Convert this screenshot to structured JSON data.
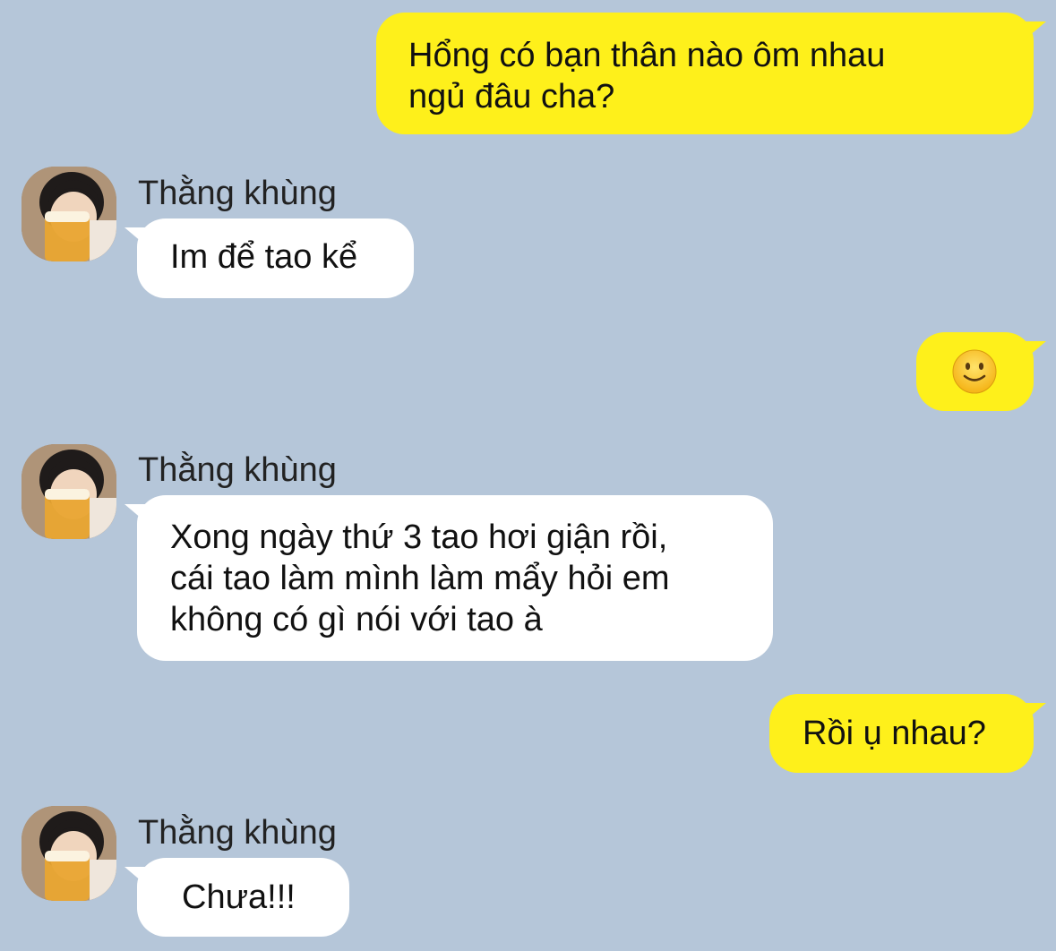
{
  "conversation": {
    "messages": [
      {
        "direction": "outgoing",
        "lines": [
          "Hổng có bạn thân nào ôm nhau",
          "ngủ đâu cha?"
        ]
      },
      {
        "direction": "incoming",
        "sender": "Thằng khùng",
        "text": "Im để tao kể"
      },
      {
        "direction": "outgoing",
        "emoji": "slightly-smiling-face-icon"
      },
      {
        "direction": "incoming",
        "sender": "Thằng khùng",
        "lines": [
          "Xong ngày thứ 3 tao hơi giận rồi,",
          "cái tao làm mình làm mẩy hỏi em",
          "không có gì nói với tao à"
        ]
      },
      {
        "direction": "outgoing",
        "text": "Rồi ụ nhau?"
      },
      {
        "direction": "incoming",
        "sender": "Thằng khùng",
        "text": "Chưa!!!"
      }
    ]
  },
  "colors": {
    "background": "#b5c6d9",
    "outgoing_bubble": "#fef01b",
    "incoming_bubble": "#ffffff"
  }
}
